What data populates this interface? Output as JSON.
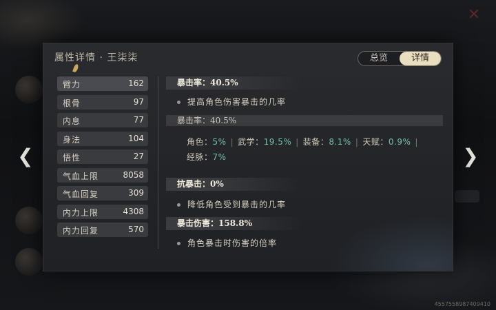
{
  "panel": {
    "title": "属性详情 · 王柒柒",
    "tabs": [
      {
        "label": "总览",
        "active": false
      },
      {
        "label": "详情",
        "active": true
      }
    ]
  },
  "stats": [
    {
      "name": "臂力",
      "value": "162"
    },
    {
      "name": "根骨",
      "value": "97"
    },
    {
      "name": "内息",
      "value": "77"
    },
    {
      "name": "身法",
      "value": "104"
    },
    {
      "name": "悟性",
      "value": "27"
    },
    {
      "name": "气血上限",
      "value": "8058"
    },
    {
      "name": "气血回复",
      "value": "309"
    },
    {
      "name": "内力上限",
      "value": "4308"
    },
    {
      "name": "内力回复",
      "value": "570"
    }
  ],
  "detail": {
    "crit_rate_head": "暴击率：40.5%",
    "crit_rate_desc": "提高角色伤害暴击的几率",
    "crit_rate_sub": "暴击率：40.5%",
    "breakdown_line1": [
      {
        "label": "角色：",
        "value": "5%"
      },
      {
        "label": "武学：",
        "value": "19.5%"
      },
      {
        "label": "装备：",
        "value": "8.1%"
      },
      {
        "label": "天赋：",
        "value": "0.9%"
      }
    ],
    "breakdown_line2": [
      {
        "label": "经脉：",
        "value": "7%"
      }
    ],
    "anti_crit_head": "抗暴击：0%",
    "anti_crit_desc": "降低角色受到暴击的几率",
    "crit_dmg_head": "暴击伤害：158.8%",
    "crit_dmg_desc": "角色暴击时伤害的倍率"
  },
  "watermark": "4557558987409410",
  "colors": {
    "accent_value": "#6fc2a3",
    "tab_active_bg": "#e9dfc0",
    "close": "#7a2b27"
  }
}
